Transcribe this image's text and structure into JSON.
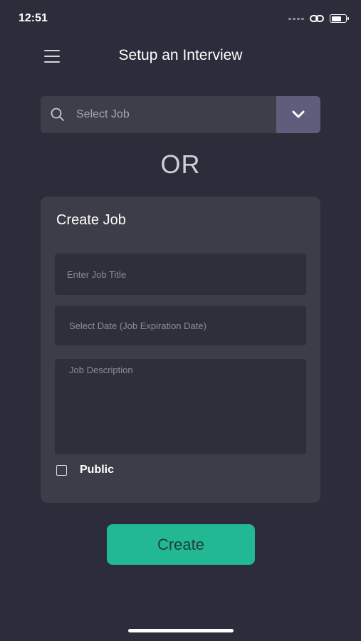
{
  "status_bar": {
    "time": "12:51",
    "icons": [
      "signal-icon",
      "link-icon",
      "battery-icon"
    ]
  },
  "header": {
    "title": "Setup an Interview",
    "menu_icon": "hamburger-menu-icon"
  },
  "job_select": {
    "placeholder": "Select Job",
    "icon": "search-icon",
    "dropdown_icon": "chevron-down-icon"
  },
  "divider_text": "OR",
  "create_job": {
    "title": "Create Job",
    "job_title_placeholder": "Enter Job Title",
    "date_placeholder": "Select Date (Job Expiration Date)",
    "description_placeholder": "Job Description",
    "public_label": "Public",
    "public_checked": false
  },
  "create_button": {
    "label": "Create"
  },
  "colors": {
    "background": "#2c2c3a",
    "card": "#3d3d49",
    "accent": "#23b894",
    "dropdown": "#5e5e7c"
  }
}
